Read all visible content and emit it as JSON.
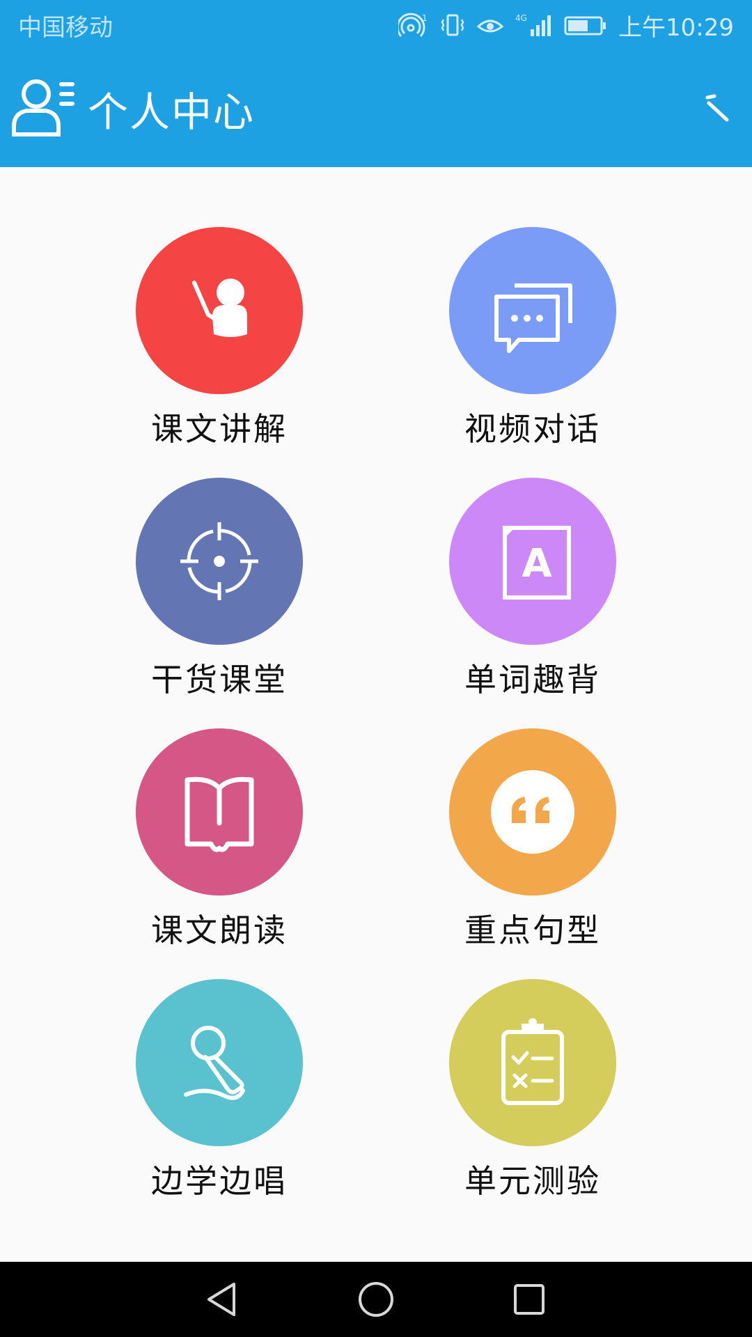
{
  "status_bar": {
    "carrier": "中国移动",
    "network": "4G",
    "time": "上午10:29"
  },
  "header": {
    "title": "个人中心"
  },
  "menu": [
    {
      "label": "课文讲解",
      "icon": "teacher-pointer-icon",
      "color": "#f54444"
    },
    {
      "label": "视频对话",
      "icon": "chat-bubbles-icon",
      "color": "#7a9cf7"
    },
    {
      "label": "干货课堂",
      "icon": "crosshair-target-icon",
      "color": "#6475b3"
    },
    {
      "label": "单词趣背",
      "icon": "letter-book-icon",
      "color": "#cc88f7"
    },
    {
      "label": "课文朗读",
      "icon": "open-book-icon",
      "color": "#d45786"
    },
    {
      "label": "重点句型",
      "icon": "quote-icon",
      "color": "#f2a84a"
    },
    {
      "label": "边学边唱",
      "icon": "microphone-icon",
      "color": "#5ac2ce"
    },
    {
      "label": "单元测验",
      "icon": "clipboard-checklist-icon",
      "color": "#d4cd5c"
    }
  ],
  "colors": {
    "brand": "#1ea1e2",
    "background": "#fafafa",
    "nav_bar": "#000000"
  }
}
